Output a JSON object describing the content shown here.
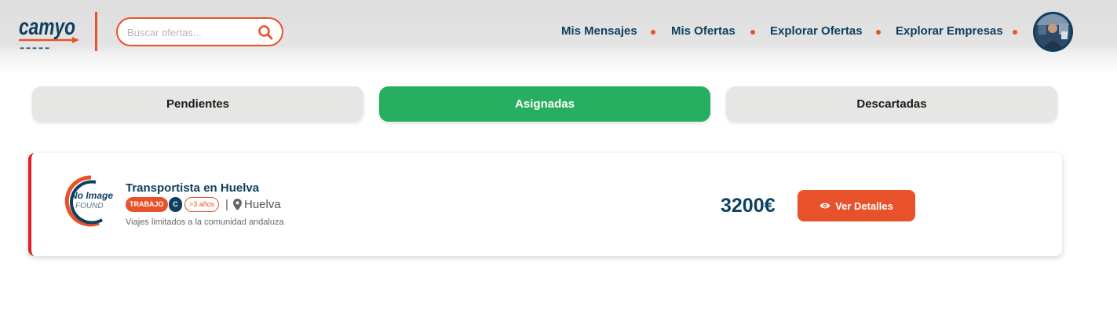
{
  "brand": {
    "logo_text": "camyo",
    "accent": "#e8522a",
    "navy": "#0d3f5f"
  },
  "search": {
    "placeholder": "Buscar ofertas...",
    "value": "",
    "icon": "search-icon"
  },
  "nav": {
    "items": [
      {
        "label": "Mis Mensajes"
      },
      {
        "label": "Mis Ofertas"
      },
      {
        "label": "Explorar Ofertas"
      },
      {
        "label": "Explorar Empresas"
      }
    ],
    "avatar": "user-avatar"
  },
  "tabs": [
    {
      "label": "Pendientes",
      "active": false
    },
    {
      "label": "Asignadas",
      "active": true
    },
    {
      "label": "Descartadas",
      "active": false
    }
  ],
  "offers": [
    {
      "image_text_top": "No Image",
      "image_text_bottom": "FOUND",
      "title": "Transportista en Huelva",
      "type_badge": "TRABAJO",
      "license_badge": "C",
      "experience_badge": ">3 años",
      "separator": "|",
      "location": "Huelva",
      "description": "Viajes limitados a la comunidad andaluza",
      "price": "3200€",
      "action_label": "Ver Detalles"
    }
  ],
  "colors": {
    "active_tab": "#27ae60",
    "tab": "#e6e6e4",
    "card_border": "#e31e24"
  }
}
